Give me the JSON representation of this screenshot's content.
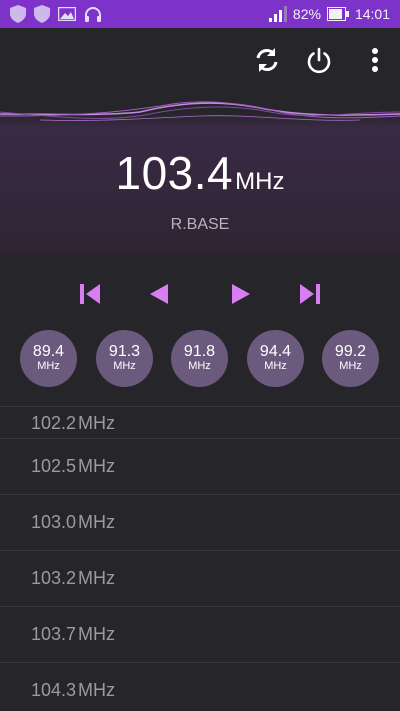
{
  "status_bar": {
    "battery_percent": "82%",
    "time": "14:01",
    "icons": [
      "shield-icon",
      "shield-icon",
      "image-icon",
      "headphones-icon",
      "signal-icon",
      "battery-icon"
    ]
  },
  "toolbar": {
    "icons": [
      "refresh-icon",
      "power-icon",
      "more-vert-icon"
    ]
  },
  "now_playing": {
    "frequency": "103.4",
    "unit": "MHz",
    "station": "R.BASE"
  },
  "controls": [
    "skip-previous-icon",
    "seek-back-icon",
    "seek-forward-icon",
    "skip-next-icon"
  ],
  "presets": [
    {
      "freq": "89.4",
      "unit": "MHz"
    },
    {
      "freq": "91.3",
      "unit": "MHz"
    },
    {
      "freq": "91.8",
      "unit": "MHz"
    },
    {
      "freq": "94.4",
      "unit": "MHz"
    },
    {
      "freq": "99.2",
      "unit": "MHz"
    }
  ],
  "stations": [
    {
      "freq": "102.2",
      "unit": "MHz"
    },
    {
      "freq": "102.5",
      "unit": "MHz"
    },
    {
      "freq": "103.0",
      "unit": "MHz"
    },
    {
      "freq": "103.2",
      "unit": "MHz"
    },
    {
      "freq": "103.7",
      "unit": "MHz"
    },
    {
      "freq": "104.3",
      "unit": "MHz"
    }
  ],
  "colors": {
    "status_bar": "#7d33c9",
    "accent": "#d97ef2",
    "preset_bg": "#6b5a7e",
    "background": "#262529"
  }
}
